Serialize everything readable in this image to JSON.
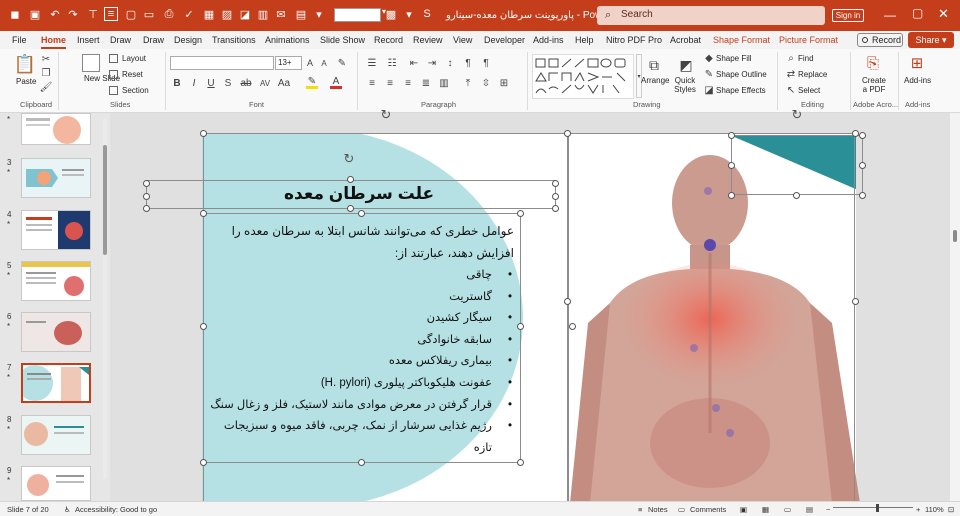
{
  "titlebar": {
    "title": "پاورپوینت سرطان معده-سینارو  -  PowerP...",
    "search_placeholder": "Search",
    "signin": "Sign in"
  },
  "tabs": [
    {
      "label": "File"
    },
    {
      "label": "Home"
    },
    {
      "label": "Insert"
    },
    {
      "label": "Draw"
    },
    {
      "label": "Draw"
    },
    {
      "label": "Design"
    },
    {
      "label": "Transitions"
    },
    {
      "label": "Animations"
    },
    {
      "label": "Slide Show"
    },
    {
      "label": "Record"
    },
    {
      "label": "Review"
    },
    {
      "label": "View"
    },
    {
      "label": "Developer"
    },
    {
      "label": "Add-ins"
    },
    {
      "label": "Help"
    },
    {
      "label": "Nitro PDF Pro"
    },
    {
      "label": "Acrobat"
    },
    {
      "label": "Shape Format"
    },
    {
      "label": "Picture Format"
    }
  ],
  "record_label": "Record",
  "share_label": "Share",
  "ribbon": {
    "clipboard": {
      "paste": "Paste",
      "label": "Clipboard"
    },
    "slides": {
      "new_slide": "New Slide",
      "layout": "Layout",
      "reset": "Reset",
      "section": "Section",
      "label": "Slides"
    },
    "font": {
      "size": "13+",
      "label": "Font"
    },
    "paragraph": {
      "label": "Paragraph"
    },
    "drawing": {
      "arrange": "Arrange",
      "quick_styles": "Quick Styles",
      "shape_fill": "Shape Fill",
      "shape_outline": "Shape Outline",
      "shape_effects": "Shape Effects",
      "label": "Drawing"
    },
    "editing": {
      "find": "Find",
      "replace": "Replace",
      "select": "Select",
      "label": "Editing"
    },
    "acrobat": {
      "create_pdf": "Create a PDF",
      "label": "Adobe Acro..."
    },
    "addins": {
      "addins": "Add-ins",
      "label": "Add-ins"
    }
  },
  "thumbnails": [
    {
      "num": "",
      "star": "*"
    },
    {
      "num": "3",
      "star": "*"
    },
    {
      "num": "4",
      "star": "*"
    },
    {
      "num": "5",
      "star": "*"
    },
    {
      "num": "6",
      "star": "*"
    },
    {
      "num": "7",
      "star": "*"
    },
    {
      "num": "8",
      "star": "*"
    },
    {
      "num": "9",
      "star": "*"
    }
  ],
  "slide": {
    "title": "علت سرطان معده",
    "intro": "عوامل خطری که می‌توانند شانس ابتلا به سرطان معده را افزایش دهند، عبارتند از:",
    "bullets": [
      "چاقی",
      "گاستریت",
      "سیگار کشیدن",
      "سابقه خانوادگی",
      "بیماری ریفلاکس معده",
      "عفونت هلیکوباکتر پیلوری (H. pylori)",
      "قرار گرفتن در معرض موادی مانند لاستیک، فلز و زغال سنگ",
      "رژیم غذایی سرشار از نمک، چربی، فاقد میوه و سبزیجات تازه"
    ],
    "accent_color": "#b5e1e4",
    "triangle_color": "#2a8f97"
  },
  "status": {
    "slide_of": "Slide 7 of 20",
    "accessibility": "Accessibility: Good to go",
    "notes": "Notes",
    "comments": "Comments",
    "zoom": "110%"
  },
  "colors": {
    "brand": "#c43e1c"
  }
}
